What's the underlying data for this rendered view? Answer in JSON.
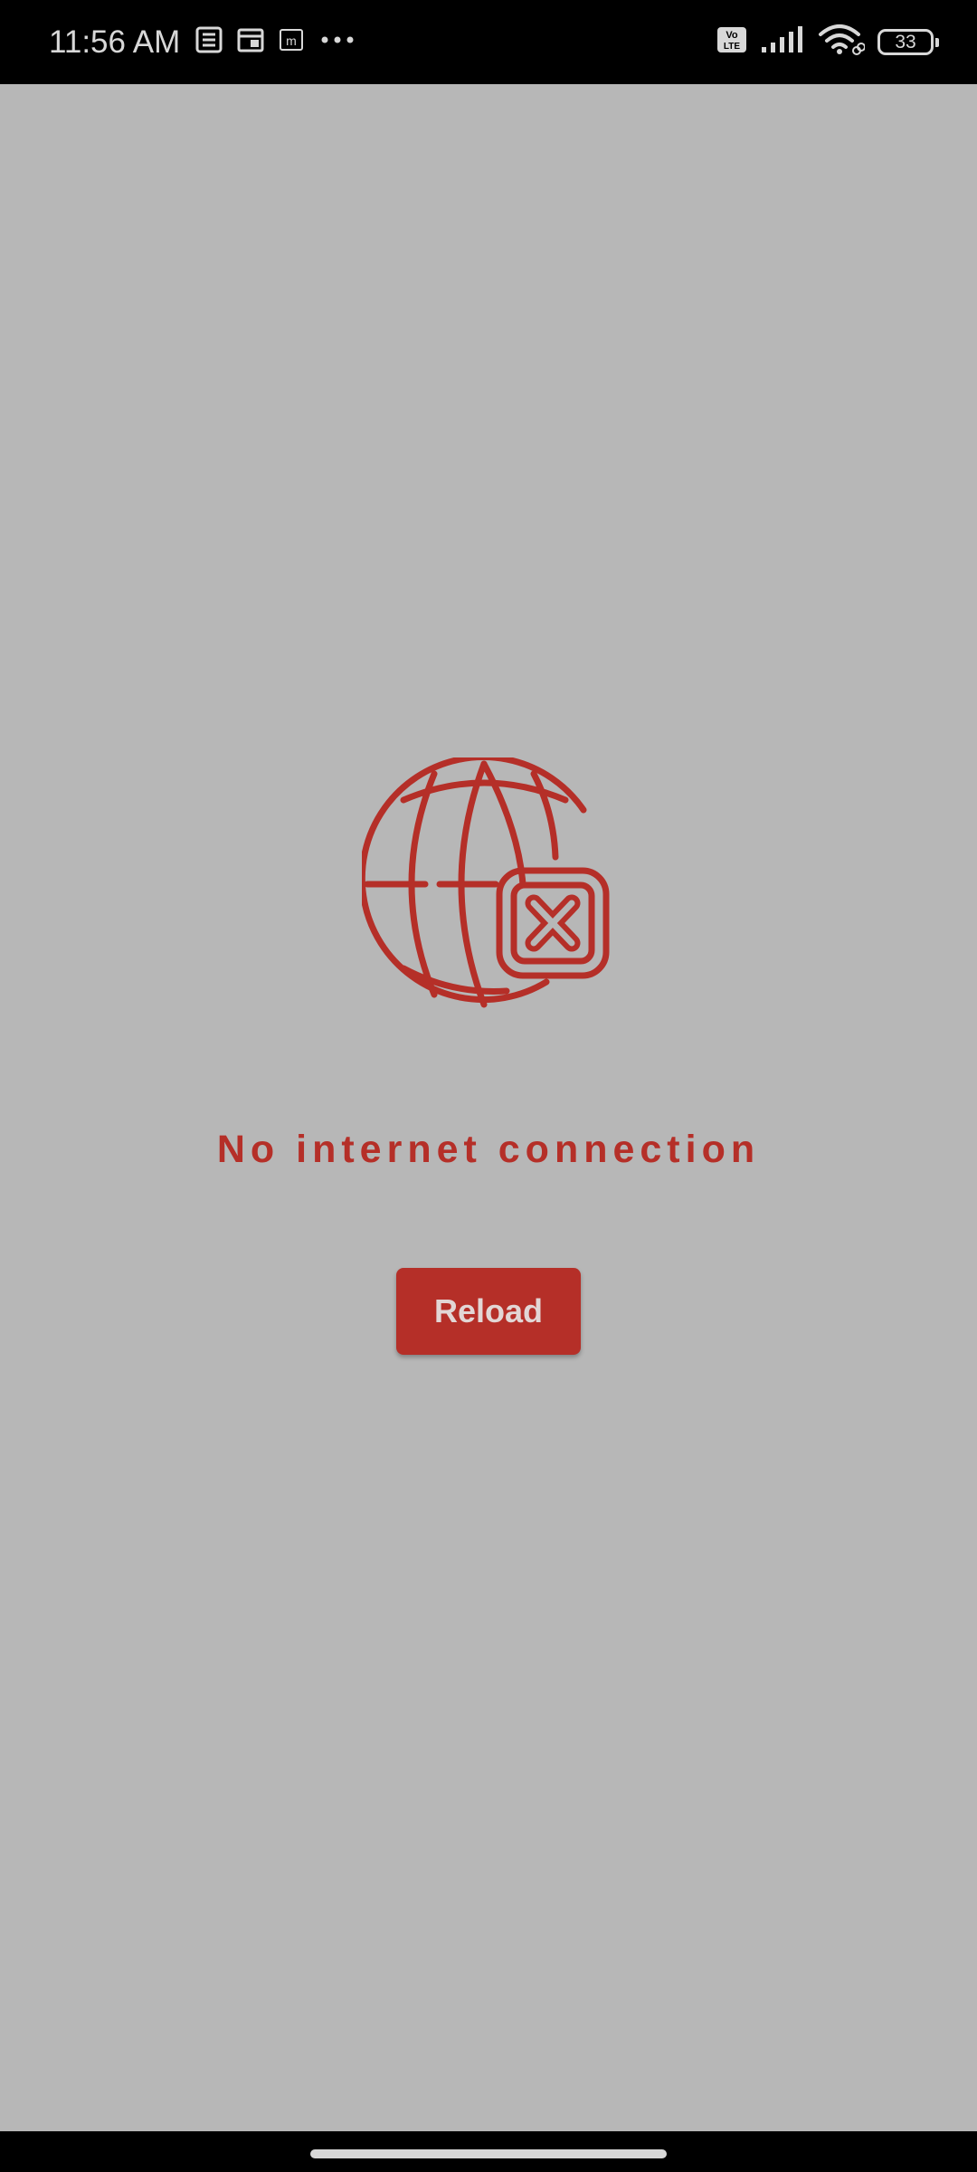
{
  "status_bar": {
    "time": "11:56 AM",
    "battery_level": "33",
    "notification_icons": [
      "news-icon",
      "calendar-icon",
      "m-app-icon",
      "more-dots-icon"
    ],
    "system_icons": [
      "volte-icon",
      "signal-icon",
      "wifi-icon",
      "battery-icon"
    ]
  },
  "error_screen": {
    "icon": "globe-no-connection-icon",
    "message": "No internet connection",
    "reload_label": "Reload"
  },
  "colors": {
    "accent": "#b52f28",
    "background": "#b7b7b7",
    "status_bar": "#000000"
  }
}
